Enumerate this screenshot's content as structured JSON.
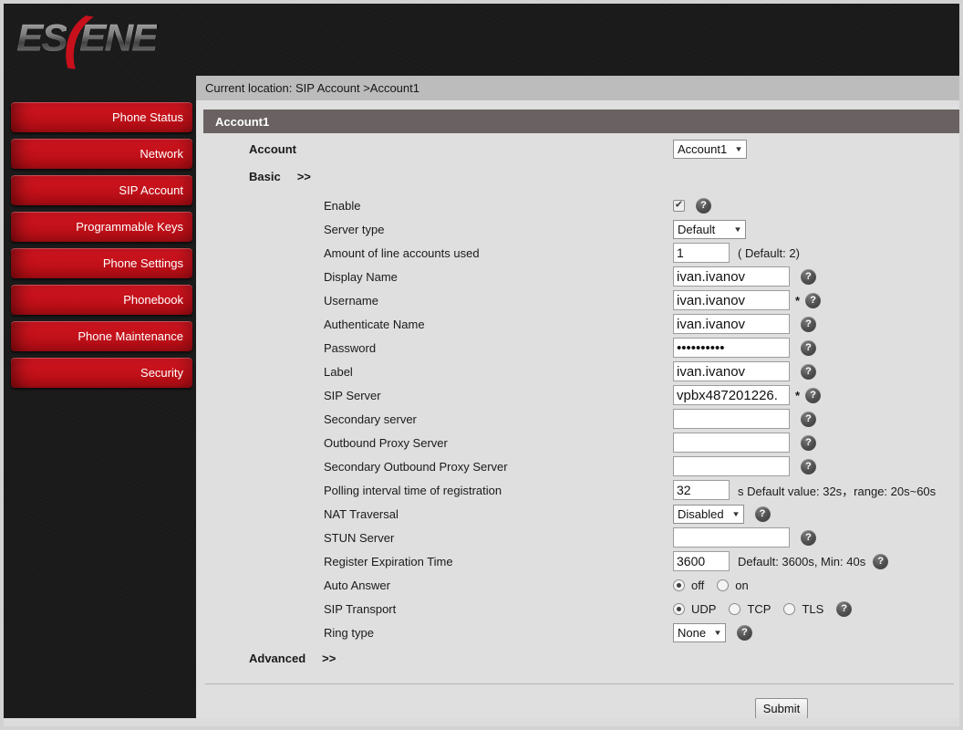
{
  "logo": {
    "text_left": "ES",
    "swoosh": "(",
    "text_right": "ENE"
  },
  "colors": {
    "accent_red": "#c1121c",
    "header_bar": "#6a6262",
    "breadcrumb_bg": "#bcbcbc"
  },
  "icons": {
    "help": "?",
    "check": "✔",
    "select_arrow": "▼"
  },
  "sidebar": {
    "items": [
      {
        "label": "Phone Status"
      },
      {
        "label": "Network"
      },
      {
        "label": "SIP Account"
      },
      {
        "label": "Programmable Keys"
      },
      {
        "label": "Phone Settings"
      },
      {
        "label": "Phonebook"
      },
      {
        "label": "Phone Maintenance"
      },
      {
        "label": "Security"
      }
    ]
  },
  "breadcrumb": "Current location: SIP Account >Account1",
  "section": {
    "title": "Account1"
  },
  "form": {
    "account": {
      "label": "Account",
      "value": "Account1"
    },
    "basic": {
      "label": "Basic",
      "arrows": ">>"
    },
    "fields": {
      "enable": {
        "label": "Enable",
        "checked": true
      },
      "server_type": {
        "label": "Server type",
        "value": "Default"
      },
      "line_accounts": {
        "label": "Amount of line accounts used",
        "value": "1",
        "note": "( Default: 2)"
      },
      "display_name": {
        "label": "Display Name",
        "value": "ivan.ivanov"
      },
      "username": {
        "label": "Username",
        "value": "ivan.ivanov",
        "required": "*"
      },
      "auth_name": {
        "label": "Authenticate Name",
        "value": "ivan.ivanov"
      },
      "password": {
        "label": "Password",
        "value": "••••••••••"
      },
      "label_field": {
        "label": "Label",
        "value": "ivan.ivanov"
      },
      "sip_server": {
        "label": "SIP Server",
        "value": "vpbx487201226.",
        "required": "*"
      },
      "secondary_server": {
        "label": "Secondary server",
        "value": ""
      },
      "outbound_proxy": {
        "label": "Outbound Proxy Server",
        "value": ""
      },
      "secondary_outbound_proxy": {
        "label": "Secondary Outbound Proxy Server",
        "value": ""
      },
      "polling_interval": {
        "label": "Polling interval time of registration",
        "value": "32",
        "note": "s Default value: 32s，range: 20s~60s"
      },
      "nat_traversal": {
        "label": "NAT Traversal",
        "value": "Disabled"
      },
      "stun_server": {
        "label": "STUN Server",
        "value": ""
      },
      "register_expiration": {
        "label": "Register Expiration Time",
        "value": "3600",
        "note": "Default: 3600s, Min: 40s"
      },
      "auto_answer": {
        "label": "Auto Answer",
        "options": [
          "off",
          "on"
        ],
        "selected": "off"
      },
      "sip_transport": {
        "label": "SIP Transport",
        "options": [
          "UDP",
          "TCP",
          "TLS"
        ],
        "selected": "UDP"
      },
      "ring_type": {
        "label": "Ring type",
        "value": "None"
      }
    },
    "advanced": {
      "label": "Advanced",
      "arrows": ">>"
    },
    "submit_label": "Submit"
  }
}
